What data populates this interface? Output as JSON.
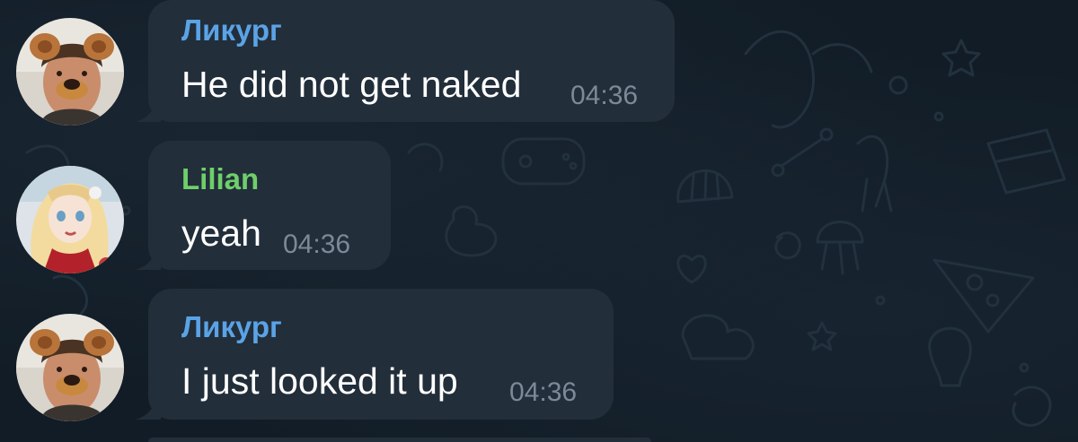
{
  "colors": {
    "background": "#111c26",
    "bubble": "#222e3a",
    "sender_blue": "#5aa3e6",
    "sender_green": "#6fcf6a",
    "message_text": "#ffffff",
    "timestamp": "#7c8a97"
  },
  "messages": [
    {
      "sender": "Ликург",
      "text": "He did not get naked",
      "time": "04:36",
      "sender_color": "#5aa3e6",
      "avatar": "guy-with-dog-filter-avatar"
    },
    {
      "sender": "Lilian",
      "text": "yeah",
      "time": "04:36",
      "sender_color": "#6fcf6a",
      "avatar": "doll-character-avatar"
    },
    {
      "sender": "Ликург",
      "text": "I just looked it up",
      "time": "04:36",
      "sender_color": "#5aa3e6",
      "avatar": "guy-with-dog-filter-avatar"
    }
  ]
}
